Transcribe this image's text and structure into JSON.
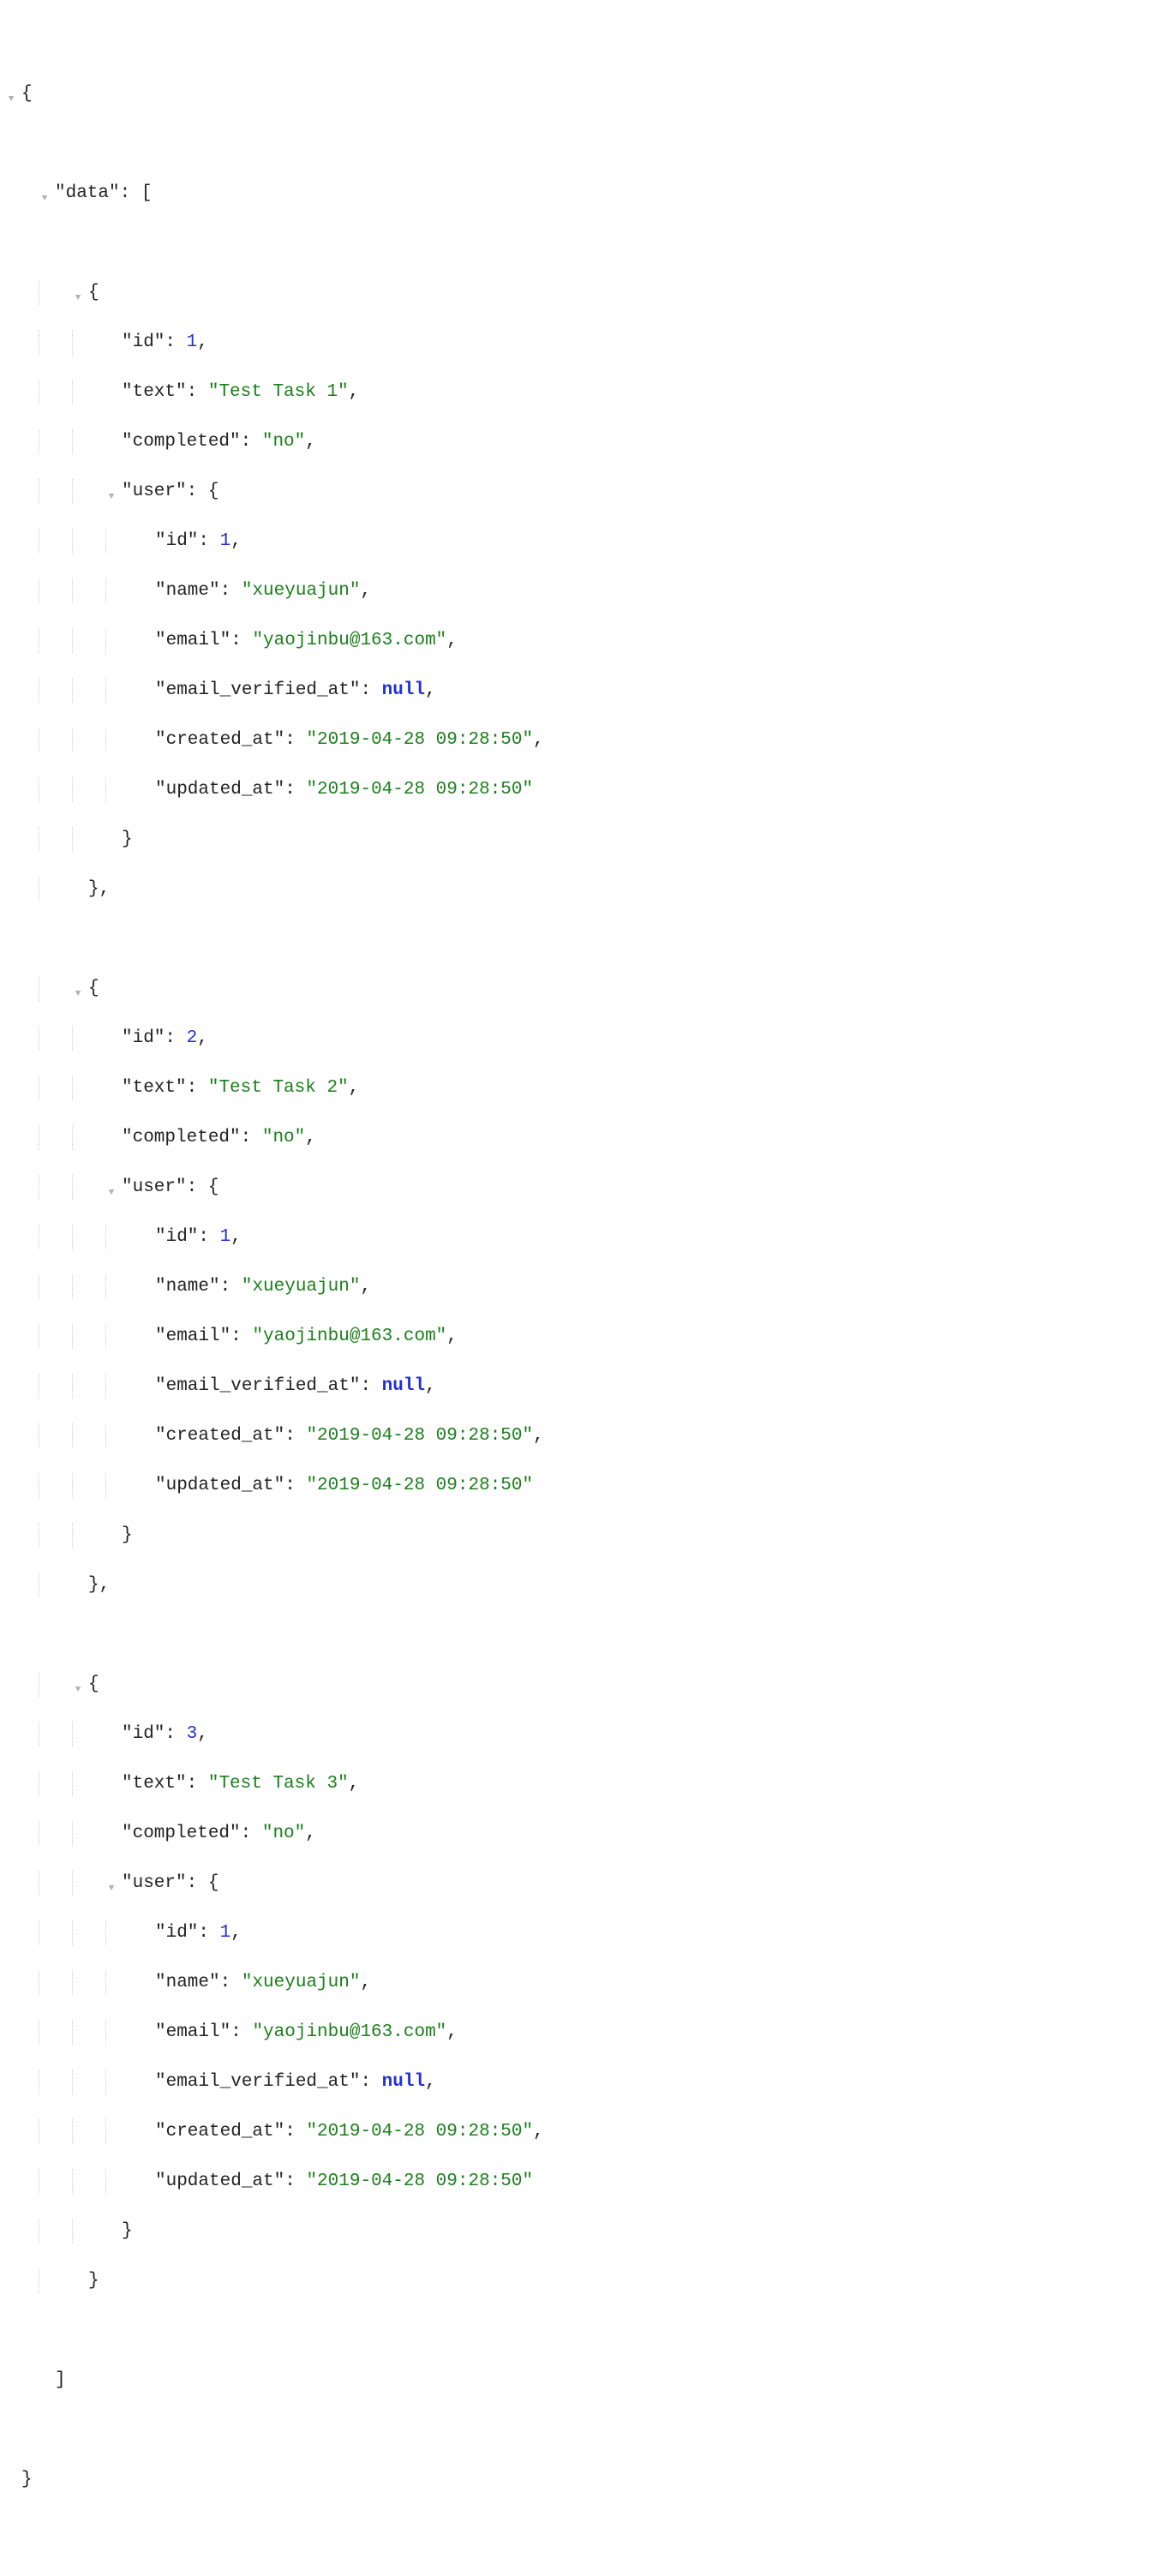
{
  "punct": {
    "brace_open": "{",
    "brace_close": "}",
    "bracket_open": "[",
    "bracket_close": "]",
    "colon_space": ": ",
    "comma": ","
  },
  "keys": {
    "data": "\"data\"",
    "id": "\"id\"",
    "text": "\"text\"",
    "completed": "\"completed\"",
    "user": "\"user\"",
    "name": "\"name\"",
    "email": "\"email\"",
    "email_verified_at": "\"email_verified_at\"",
    "created_at": "\"created_at\"",
    "updated_at": "\"updated_at\""
  },
  "items": [
    {
      "id": "1",
      "text": "\"Test Task 1\"",
      "completed": "\"no\"",
      "user": {
        "id": "1",
        "name": "\"xueyuajun\"",
        "email": "\"yaojinbu@163.com\"",
        "email_verified_at": "null",
        "created_at": "\"2019-04-28 09:28:50\"",
        "updated_at": "\"2019-04-28 09:28:50\""
      }
    },
    {
      "id": "2",
      "text": "\"Test Task 2\"",
      "completed": "\"no\"",
      "user": {
        "id": "1",
        "name": "\"xueyuajun\"",
        "email": "\"yaojinbu@163.com\"",
        "email_verified_at": "null",
        "created_at": "\"2019-04-28 09:28:50\"",
        "updated_at": "\"2019-04-28 09:28:50\""
      }
    },
    {
      "id": "3",
      "text": "\"Test Task 3\"",
      "completed": "\"no\"",
      "user": {
        "id": "1",
        "name": "\"xueyuajun\"",
        "email": "\"yaojinbu@163.com\"",
        "email_verified_at": "null",
        "created_at": "\"2019-04-28 09:28:50\"",
        "updated_at": "\"2019-04-28 09:28:50\""
      }
    }
  ]
}
